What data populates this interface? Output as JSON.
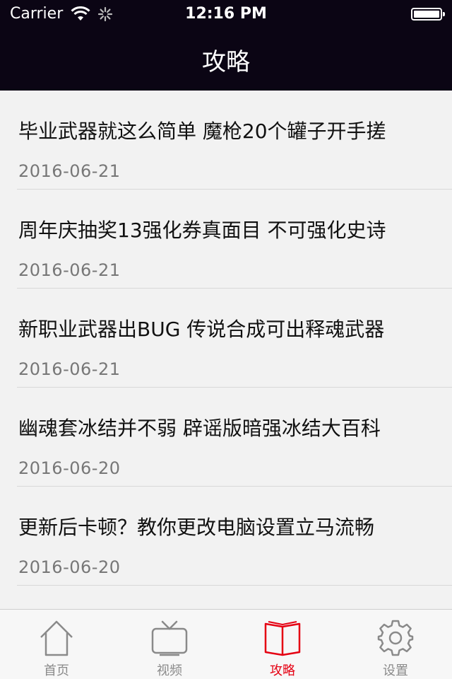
{
  "status_bar": {
    "carrier": "Carrier",
    "time": "12:16 PM",
    "icons": [
      "wifi-icon",
      "activity-spinner-icon",
      "battery-icon"
    ]
  },
  "nav": {
    "title": "攻略"
  },
  "articles": [
    {
      "title": "毕业武器就这么简单 魔枪20个罐子开手搓",
      "date": "2016-06-21"
    },
    {
      "title": "周年庆抽奖13强化券真面目 不可强化史诗",
      "date": "2016-06-21"
    },
    {
      "title": "新职业武器出BUG 传说合成可出释魂武器",
      "date": "2016-06-21"
    },
    {
      "title": "幽魂套冰结并不弱 辟谣版暗强冰结大百科",
      "date": "2016-06-20"
    },
    {
      "title": "更新后卡顿？教你更改电脑设置立马流畅",
      "date": "2016-06-20"
    }
  ],
  "tabbar": {
    "active_color": "#e50012",
    "inactive_color": "#8a8a8a",
    "tabs": [
      {
        "label": "首页",
        "icon": "home-icon"
      },
      {
        "label": "视频",
        "icon": "tv-icon"
      },
      {
        "label": "攻略",
        "icon": "book-icon",
        "active": true
      },
      {
        "label": "设置",
        "icon": "gear-icon"
      }
    ]
  }
}
